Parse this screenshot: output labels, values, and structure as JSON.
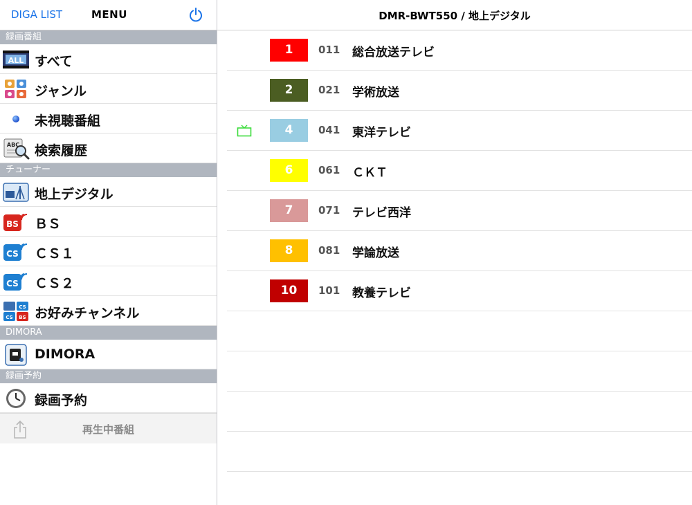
{
  "sidebar": {
    "back_label": "DIGA LIST",
    "title": "MENU",
    "power_icon": "power-icon",
    "sections": {
      "recordings": "録画番組",
      "tuner": "チューナー",
      "dimora": "DIMORA",
      "reservation": "録画予約"
    },
    "items": {
      "all": {
        "label": "すべて",
        "icon": "all-icon"
      },
      "genre": {
        "label": "ジャンル",
        "icon": "genre-icon"
      },
      "unwatched": {
        "label": "未視聴番組",
        "icon": "blue-dot-icon"
      },
      "history": {
        "label": "検索履歴",
        "icon": "search-history-icon"
      },
      "terrestrial": {
        "label": "地上デジタル",
        "icon": "terrestrial-icon"
      },
      "bs": {
        "label": "ＢＳ",
        "icon": "bs-icon"
      },
      "cs1": {
        "label": "ＣＳ１",
        "icon": "cs-icon"
      },
      "cs2": {
        "label": "ＣＳ２",
        "icon": "cs-icon"
      },
      "favorites": {
        "label": "お好みチャンネル",
        "icon": "favorites-icon"
      },
      "dimora": {
        "label": "DIMORA",
        "icon": "dimora-icon"
      },
      "reservation": {
        "label": "録画予約",
        "icon": "clock-icon"
      }
    },
    "now_playing": "再生中番組"
  },
  "main": {
    "title": "DMR-BWT550 / 地上デジタル",
    "channels": [
      {
        "badge": "1",
        "color": "#ff0000",
        "number": "011",
        "name": "総合放送テレビ",
        "current": false
      },
      {
        "badge": "2",
        "color": "#4b5d22",
        "number": "021",
        "name": "学術放送",
        "current": false
      },
      {
        "badge": "4",
        "color": "#99cde2",
        "number": "041",
        "name": "東洋テレビ",
        "current": true
      },
      {
        "badge": "6",
        "color": "#ffff00",
        "number": "061",
        "name": "ＣＫＴ",
        "current": false
      },
      {
        "badge": "7",
        "color": "#d99999",
        "number": "071",
        "name": "テレビ西洋",
        "current": false
      },
      {
        "badge": "8",
        "color": "#ffc000",
        "number": "081",
        "name": "学論放送",
        "current": false
      },
      {
        "badge": "10",
        "color": "#c00000",
        "number": "101",
        "name": "教養テレビ",
        "current": false
      }
    ]
  },
  "colors": {
    "accent": "#1a73e8",
    "section_bg": "#b0b6bf",
    "current_tv": "#3ddc3d"
  }
}
